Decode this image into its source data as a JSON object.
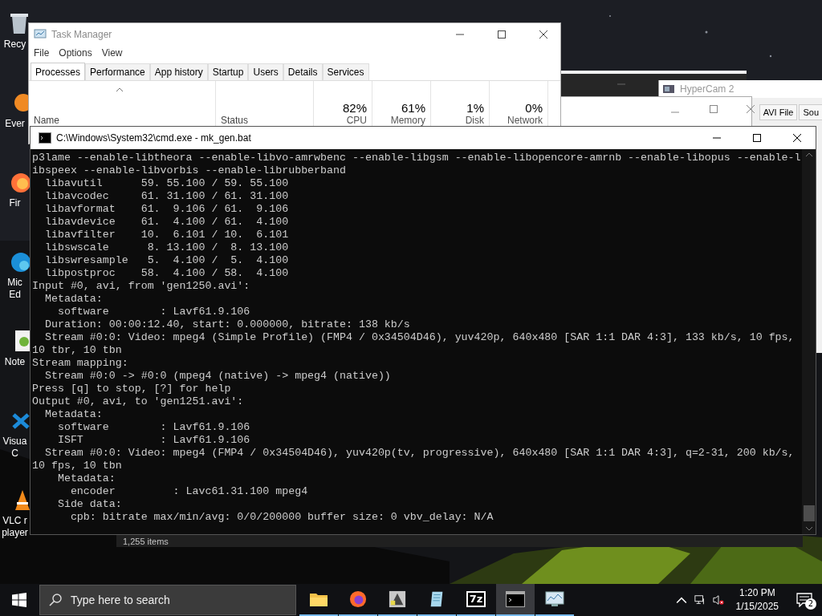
{
  "desktop_icons": [
    {
      "kind": "recycle",
      "lines": [
        "Recy"
      ]
    },
    {
      "kind": "app",
      "lines": [
        "Ever"
      ]
    },
    {
      "kind": "firefox",
      "lines": [
        "Fir"
      ]
    },
    {
      "kind": "edge",
      "lines": [
        "Mic",
        "Ed"
      ]
    },
    {
      "kind": "notepad",
      "lines": [
        "Note"
      ]
    },
    {
      "kind": "vscode",
      "lines": [
        "Visua",
        "C"
      ]
    },
    {
      "kind": "vlc",
      "lines": [
        "VLC r",
        "player"
      ]
    }
  ],
  "task_manager": {
    "title": "Task Manager",
    "menu": [
      "File",
      "Options",
      "View"
    ],
    "tabs": [
      {
        "label": "Processes",
        "selected": true
      },
      {
        "label": "Performance",
        "selected": false
      },
      {
        "label": "App history",
        "selected": false
      },
      {
        "label": "Startup",
        "selected": false
      },
      {
        "label": "Users",
        "selected": false
      },
      {
        "label": "Details",
        "selected": false
      },
      {
        "label": "Services",
        "selected": false
      }
    ],
    "columns": [
      "Name",
      "Status"
    ],
    "metrics": [
      {
        "value": "82%",
        "label": "CPU"
      },
      {
        "value": "61%",
        "label": "Memory"
      },
      {
        "value": "1%",
        "label": "Disk"
      },
      {
        "value": "0%",
        "label": "Network"
      }
    ]
  },
  "hypercam": {
    "title": "HyperCam 2",
    "tabs": [
      "AVI File",
      "Sou"
    ]
  },
  "explorer": {
    "status": "1,255 items"
  },
  "cmd": {
    "title": "C:\\Windows\\System32\\cmd.exe - mk_gen.bat",
    "lines": [
      "p3lame --enable-libtheora --enable-libvo-amrwbenc --enable-libgsm --enable-libopencore-amrnb --enable-libopus --enable-l",
      "ibspeex --enable-libvorbis --enable-librubberband",
      "  libavutil      59. 55.100 / 59. 55.100",
      "  libavcodec     61. 31.100 / 61. 31.100",
      "  libavformat    61.  9.106 / 61.  9.106",
      "  libavdevice    61.  4.100 / 61.  4.100",
      "  libavfilter    10.  6.101 / 10.  6.101",
      "  libswscale      8. 13.100 /  8. 13.100",
      "  libswresample   5.  4.100 /  5.  4.100",
      "  libpostproc    58.  4.100 / 58.  4.100",
      "Input #0, avi, from 'gen1250.avi':",
      "  Metadata:",
      "    software        : Lavf61.9.106",
      "  Duration: 00:00:12.40, start: 0.000000, bitrate: 138 kb/s",
      "  Stream #0:0: Video: mpeg4 (Simple Profile) (FMP4 / 0x34504D46), yuv420p, 640x480 [SAR 1:1 DAR 4:3], 133 kb/s, 10 fps,",
      "10 tbr, 10 tbn",
      "Stream mapping:",
      "  Stream #0:0 -> #0:0 (mpeg4 (native) -> mpeg4 (native))",
      "Press [q] to stop, [?] for help",
      "Output #0, avi, to 'gen1251.avi':",
      "  Metadata:",
      "    software        : Lavf61.9.106",
      "    ISFT            : Lavf61.9.106",
      "  Stream #0:0: Video: mpeg4 (FMP4 / 0x34504D46), yuv420p(tv, progressive), 640x480 [SAR 1:1 DAR 4:3], q=2-31, 200 kb/s,",
      "10 fps, 10 tbn",
      "    Metadata:",
      "      encoder         : Lavc61.31.100 mpeg4",
      "    Side data:",
      "      cpb: bitrate max/min/avg: 0/0/200000 buffer size: 0 vbv_delay: N/A"
    ]
  },
  "taskbar": {
    "search_placeholder": "Type here to search",
    "apps": [
      {
        "kind": "folder",
        "selected": false
      },
      {
        "kind": "firefox",
        "selected": false
      },
      {
        "kind": "hypercam",
        "selected": false
      },
      {
        "kind": "notepad",
        "selected": false
      },
      {
        "kind": "sevenzip",
        "label": "7z",
        "selected": false
      },
      {
        "kind": "cmd",
        "selected": true
      },
      {
        "kind": "taskmgr",
        "selected": false
      }
    ],
    "time": "1:20 PM",
    "date": "1/15/2025",
    "notifications": "2"
  }
}
